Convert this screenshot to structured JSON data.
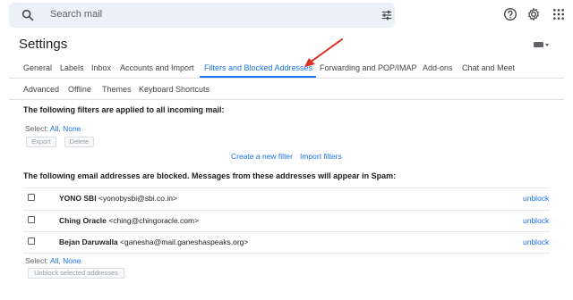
{
  "header": {
    "search_placeholder": "Search mail",
    "icons": [
      "search-icon",
      "tune-icon",
      "help-icon",
      "gear-icon",
      "apps-icon"
    ]
  },
  "page": {
    "title": "Settings"
  },
  "tabs_row1": [
    {
      "label": "General"
    },
    {
      "label": "Labels"
    },
    {
      "label": "Inbox"
    },
    {
      "label": "Accounts and Import"
    },
    {
      "label": "Filters and Blocked Addresses"
    },
    {
      "label": "Forwarding and POP/IMAP"
    },
    {
      "label": "Add-ons"
    },
    {
      "label": "Chat and Meet"
    }
  ],
  "tabs_row2": [
    {
      "label": "Advanced"
    },
    {
      "label": "Offline"
    },
    {
      "label": "Themes"
    },
    {
      "label": "Keyboard Shortcuts"
    }
  ],
  "filters": {
    "heading": "The following filters are applied to all incoming mail:",
    "select_label": "Select:",
    "select_all": "All",
    "select_none": "None",
    "export_label": "Export",
    "delete_label": "Delete",
    "create_label": "Create a new filter",
    "import_label": "Import filters"
  },
  "blocked": {
    "heading": "The following email addresses are blocked. Messages from these addresses will appear in Spam:",
    "rows": [
      {
        "name": "YONO SBI",
        "email": "<yonobysbi@sbi.co.in>",
        "action": "unblock"
      },
      {
        "name": "Ching Oracle",
        "email": "<ching@chingoracle.com>",
        "action": "unblock"
      },
      {
        "name": "Bejan Daruwalla",
        "email": "<ganesha@mail.ganeshaspeaks.org>",
        "action": "unblock"
      }
    ],
    "select_label": "Select:",
    "select_all": "All",
    "select_none": "None",
    "unblock_selected_label": "Unblock selected addresses"
  },
  "colors": {
    "accent": "#1a73e8",
    "arrow": "#d93025",
    "search_bg": "#eaf1fb"
  }
}
